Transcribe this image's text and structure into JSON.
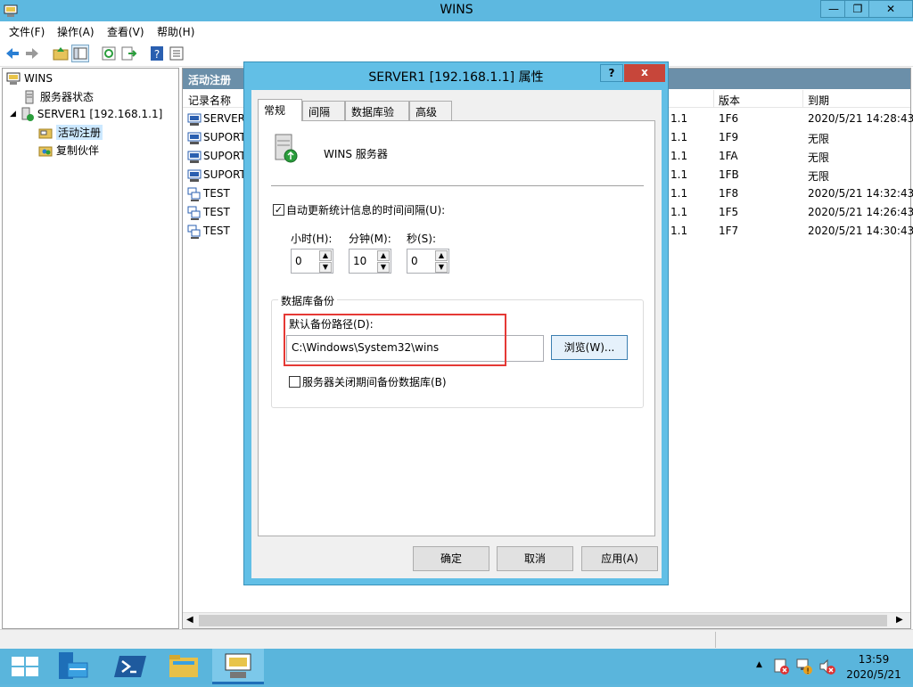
{
  "window": {
    "title": "WINS"
  },
  "menus": [
    "文件(F)",
    "操作(A)",
    "查看(V)",
    "帮助(H)"
  ],
  "toolbar_icons": [
    "back-arrow-icon",
    "forward-arrow-icon",
    "up-folder-icon",
    "show-hide-tree-icon",
    "refresh-icon",
    "export-icon",
    "help-icon",
    "properties-icon"
  ],
  "tree": {
    "root": "WINS",
    "server_status": "服务器状态",
    "server": "SERVER1 [192.168.1.1]",
    "active_reg": "活动注册",
    "partners": "复制伙伴"
  },
  "right_pane": {
    "header": "活动注册",
    "columns": {
      "name": "记录名称",
      "version": "版本",
      "expiry": "到期"
    },
    "rows": [
      {
        "name": "SERVER",
        "addr": "1.1",
        "version": "1F6",
        "expiry": "2020/5/21 14:28:43"
      },
      {
        "name": "SUPORT",
        "addr": "1.1",
        "version": "1F9",
        "expiry": "无限"
      },
      {
        "name": "SUPORT",
        "addr": "1.1",
        "version": "1FA",
        "expiry": "无限"
      },
      {
        "name": "SUPORT",
        "addr": "1.1",
        "version": "1FB",
        "expiry": "无限"
      },
      {
        "name": "TEST",
        "addr": "1.1",
        "version": "1F8",
        "expiry": "2020/5/21 14:32:43"
      },
      {
        "name": "TEST",
        "addr": "1.1",
        "version": "1F5",
        "expiry": "2020/5/21 14:26:43"
      },
      {
        "name": "TEST",
        "addr": "1.1",
        "version": "1F7",
        "expiry": "2020/5/21 14:30:43"
      }
    ]
  },
  "dialog": {
    "title": "SERVER1 [192.168.1.1] 属性",
    "tabs": [
      "常规",
      "间隔",
      "数据库验证",
      "高级"
    ],
    "server_label": "WINS 服务器",
    "auto_update_label": "自动更新统计信息的时间间隔(U):",
    "auto_update_checked": true,
    "hours_label": "小时(H):",
    "minutes_label": "分钟(M):",
    "seconds_label": "秒(S):",
    "hours": "0",
    "minutes": "10",
    "seconds": "0",
    "db_backup_group": "数据库备份",
    "default_path_label": "默认备份路径(D):",
    "backup_path": "C:\\Windows\\System32\\wins",
    "browse": "浏览(W)...",
    "backup_on_shutdown": "服务器关闭期间备份数据库(B)",
    "backup_on_shutdown_checked": false,
    "ok": "确定",
    "cancel": "取消",
    "apply": "应用(A)",
    "help_btn": "?",
    "close_btn": "x"
  },
  "taskbar": {
    "time": "13:59",
    "date": "2020/5/21"
  },
  "colors": {
    "titlebar": "#5db8e0",
    "highlight": "#e53935",
    "taskbar": "#5ab5dc"
  }
}
